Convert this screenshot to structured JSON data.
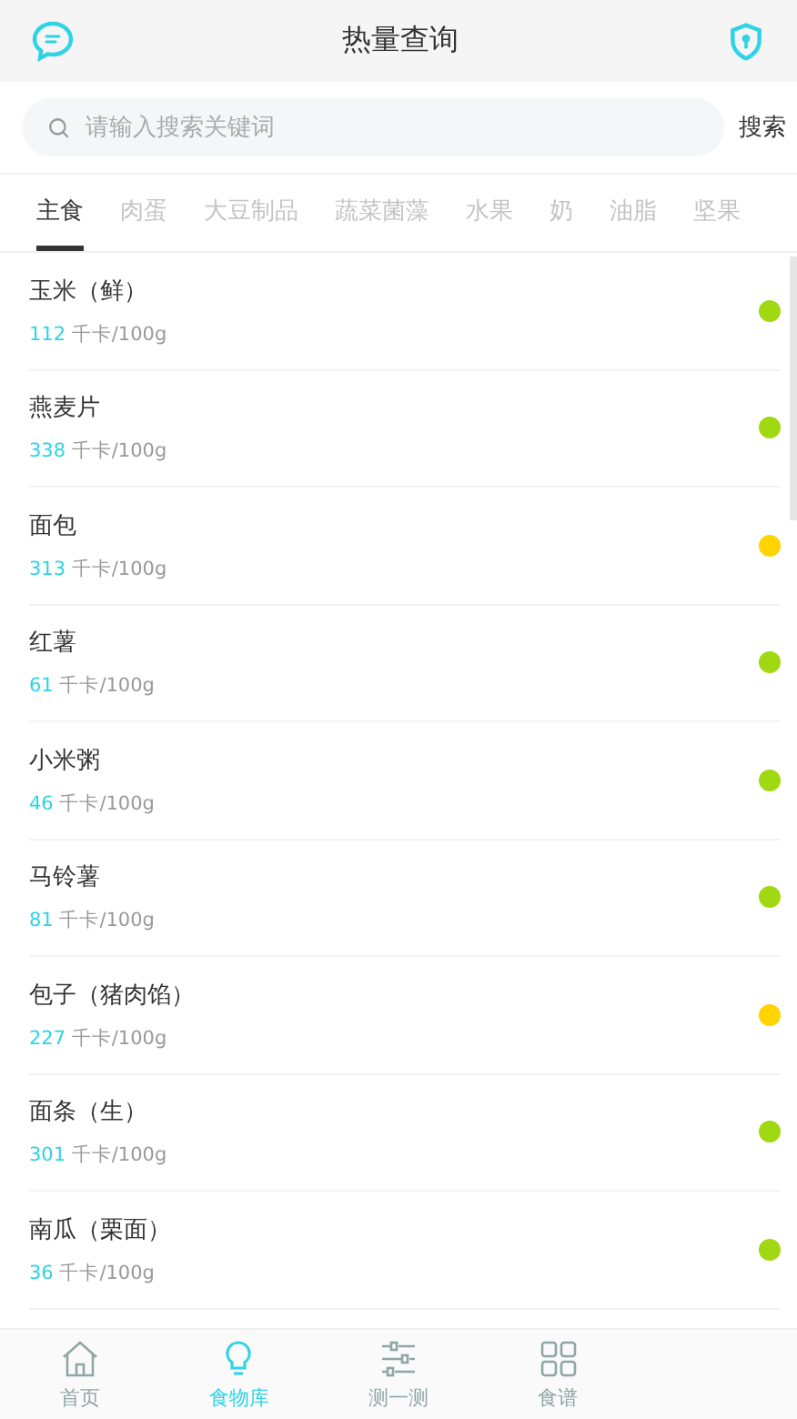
{
  "header": {
    "title": "热量查询"
  },
  "search": {
    "placeholder": "请输入搜索关键词",
    "button": "搜索"
  },
  "tabs": [
    {
      "label": "主食",
      "selected": true
    },
    {
      "label": "肉蛋",
      "selected": false
    },
    {
      "label": "大豆制品",
      "selected": false
    },
    {
      "label": "蔬菜菌藻",
      "selected": false
    },
    {
      "label": "水果",
      "selected": false
    },
    {
      "label": "奶",
      "selected": false
    },
    {
      "label": "油脂",
      "selected": false
    },
    {
      "label": "坚果",
      "selected": false
    }
  ],
  "foods": [
    {
      "name": "玉米（鲜）",
      "calories": "112",
      "unit": "千卡/100g",
      "color": "#a0d911"
    },
    {
      "name": "燕麦片",
      "calories": "338",
      "unit": "千卡/100g",
      "color": "#a0d911"
    },
    {
      "name": "面包",
      "calories": "313",
      "unit": "千卡/100g",
      "color": "#ffd400"
    },
    {
      "name": "红薯",
      "calories": "61",
      "unit": "千卡/100g",
      "color": "#a0d911"
    },
    {
      "name": "小米粥",
      "calories": "46",
      "unit": "千卡/100g",
      "color": "#a0d911"
    },
    {
      "name": "马铃薯",
      "calories": "81",
      "unit": "千卡/100g",
      "color": "#a0d911"
    },
    {
      "name": "包子（猪肉馅）",
      "calories": "227",
      "unit": "千卡/100g",
      "color": "#ffd400"
    },
    {
      "name": "面条（生）",
      "calories": "301",
      "unit": "千卡/100g",
      "color": "#a0d911"
    },
    {
      "name": "南瓜（栗面）",
      "calories": "36",
      "unit": "千卡/100g",
      "color": "#a0d911"
    }
  ],
  "nav": [
    {
      "label": "首页",
      "kind": "home",
      "selected": false
    },
    {
      "label": "食物库",
      "kind": "bulb",
      "selected": true
    },
    {
      "label": "测一测",
      "kind": "sliders",
      "selected": false
    },
    {
      "label": "食谱",
      "kind": "grid",
      "selected": false
    }
  ]
}
